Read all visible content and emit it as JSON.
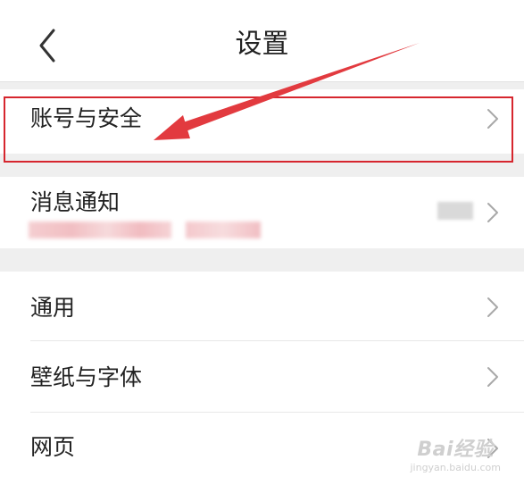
{
  "header": {
    "title": "设置",
    "back_icon": "chevron-left-icon"
  },
  "settings": {
    "items": [
      {
        "label": "账号与安全",
        "icon": "chevron-right-icon"
      },
      {
        "label": "消息通知",
        "icon": "chevron-right-icon"
      },
      {
        "label": "通用",
        "icon": "chevron-right-icon"
      },
      {
        "label": "壁纸与字体",
        "icon": "chevron-right-icon"
      },
      {
        "label": "网页",
        "icon": "chevron-right-icon"
      }
    ]
  },
  "annotation": {
    "highlight_color": "#d6262e",
    "arrow_color": "#e23a3f"
  },
  "watermark": {
    "brand": "Bai经验",
    "url": "jingyan.baidu.com"
  }
}
